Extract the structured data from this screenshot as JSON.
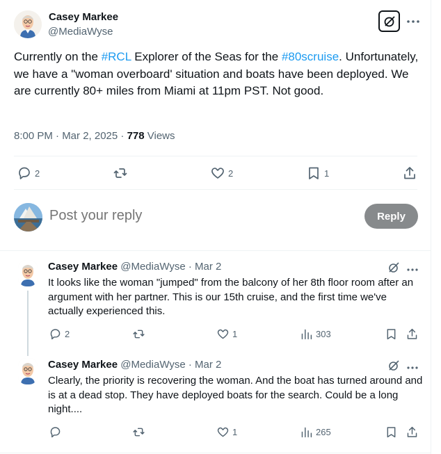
{
  "main_tweet": {
    "author_name": "Casey Markee",
    "author_handle": "@MediaWyse",
    "text_1": "Currently on the ",
    "hashtag_1": "#RCL",
    "text_2": " Explorer of the Seas for the ",
    "hashtag_2": "#80scruise",
    "text_3": ". Unfortunately, we have a \"woman overboard' situation and boats have been deployed. We are currently 80+ miles from Miami at 11pm PST. Not good.",
    "timestamp": "8:00 PM · Mar 2, 2025 · ",
    "views_count": "778",
    "views_label": " Views",
    "actions": {
      "replies": "2",
      "reposts": "",
      "likes": "2",
      "bookmarks": "1"
    }
  },
  "reply_box": {
    "placeholder": "Post your reply",
    "button_label": "Reply"
  },
  "replies": [
    {
      "author_name": "Casey Markee",
      "meta": " @MediaWyse · Mar 2",
      "text": "It looks like the woman \"jumped\" from the balcony of her 8th floor room after an argument with her partner. This is our 15th cruise, and the first time we've actually experienced this.",
      "replies": "2",
      "reposts": "",
      "likes": "1",
      "views": "303"
    },
    {
      "author_name": "Casey Markee",
      "meta": " @MediaWyse · Mar 2",
      "text": "Clearly, the priority is recovering the woman. And the boat has turned around and is at a dead stop. They have deployed boats for the search. Could be a long night....",
      "replies": "",
      "reposts": "",
      "likes": "1",
      "views": "265"
    }
  ],
  "colors": {
    "link": "#1d9bf0",
    "muted": "#536471",
    "text": "#0f1419",
    "reply_button": "#878a8c"
  },
  "icons": [
    "grok-icon",
    "more-icon",
    "reply-icon",
    "repost-icon",
    "like-icon",
    "bookmark-icon",
    "share-icon",
    "views-icon"
  ]
}
